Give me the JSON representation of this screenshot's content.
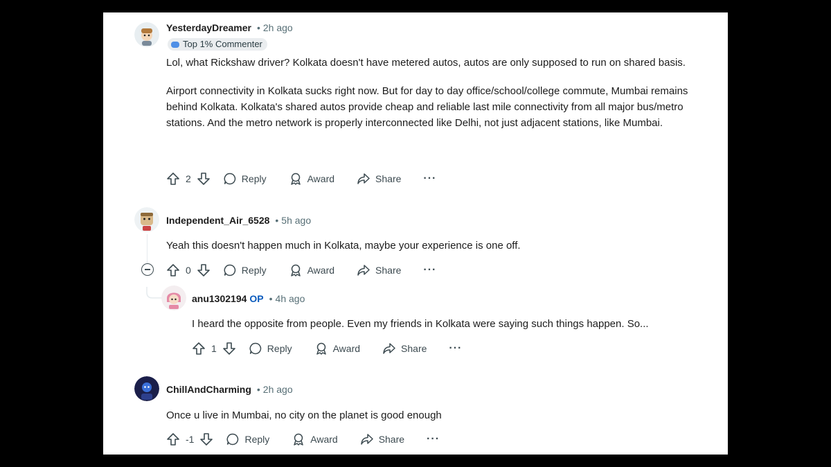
{
  "comments": [
    {
      "author": "YesterdayDreamer",
      "time": "2h ago",
      "badge": "Top 1% Commenter",
      "paragraphs": [
        "Lol, what Rickshaw driver? Kolkata doesn't have metered autos, autos are only supposed to run on shared basis.",
        "Airport connectivity in Kolkata sucks right now. But for day to day office/school/college commute, Mumbai remains behind Kolkata. Kolkata's shared autos provide cheap and reliable last mile connectivity from all major bus/metro stations. And the metro network is properly interconnected like Delhi, not just adjacent stations, like Mumbai."
      ],
      "votes": "2"
    },
    {
      "author": "Independent_Air_6528",
      "time": "5h ago",
      "paragraphs": [
        "Yeah this doesn't happen much in Kolkata, maybe your experience is one off."
      ],
      "votes": "0"
    },
    {
      "author": "anu1302194",
      "op_label": "OP",
      "time": "4h ago",
      "paragraphs": [
        "I heard the opposite from people. Even my friends in Kolkata were saying such things happen. So..."
      ],
      "votes": "1"
    },
    {
      "author": "ChillAndCharming",
      "time": "2h ago",
      "paragraphs": [
        "Once u live in Mumbai, no city on the planet is good enough"
      ],
      "votes": "-1"
    }
  ],
  "actions": {
    "reply": "Reply",
    "award": "Award",
    "share": "Share",
    "more": "···"
  },
  "separator": "•",
  "colors": {
    "background": "#000000",
    "panel": "#ffffff",
    "op": "#0a5bbd",
    "meta": "#576f76"
  }
}
